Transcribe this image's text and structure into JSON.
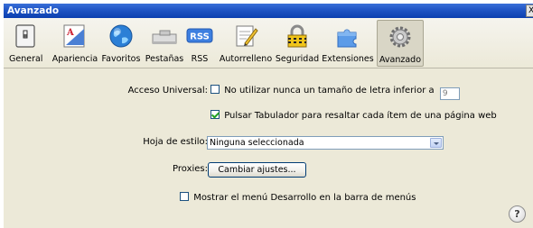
{
  "window": {
    "title": "Avanzado",
    "close_glyph": "X"
  },
  "toolbar": {
    "items": [
      {
        "label": "General",
        "icon": "switch-icon"
      },
      {
        "label": "Apariencia",
        "icon": "font-icon"
      },
      {
        "label": "Favoritos",
        "icon": "globe-icon"
      },
      {
        "label": "Pestañas",
        "icon": "tabs-icon"
      },
      {
        "label": "RSS",
        "icon": "rss-icon",
        "badge": "RSS"
      },
      {
        "label": "Autorrelleno",
        "icon": "pencil-form-icon"
      },
      {
        "label": "Seguridad",
        "icon": "lock-icon"
      },
      {
        "label": "Extensiones",
        "icon": "puzzle-icon"
      },
      {
        "label": "Avanzado",
        "icon": "gear-icon",
        "active": true
      }
    ]
  },
  "accessibility": {
    "label": "Acceso Universal:",
    "min_font_text": "No utilizar nunca un tamaño de letra inferior a",
    "min_font_checked": false,
    "min_font_value": "9",
    "tab_text": "Pulsar Tabulador para resaltar cada ítem de una página web",
    "tab_checked": true
  },
  "stylesheet": {
    "label": "Hoja de estilo:",
    "value": "Ninguna seleccionada"
  },
  "proxies": {
    "label": "Proxies:",
    "button": "Cambiar ajustes..."
  },
  "develop_menu": {
    "text": "Mostrar el menú Desarrollo en la barra de menús",
    "checked": false
  },
  "help": {
    "glyph": "?"
  }
}
